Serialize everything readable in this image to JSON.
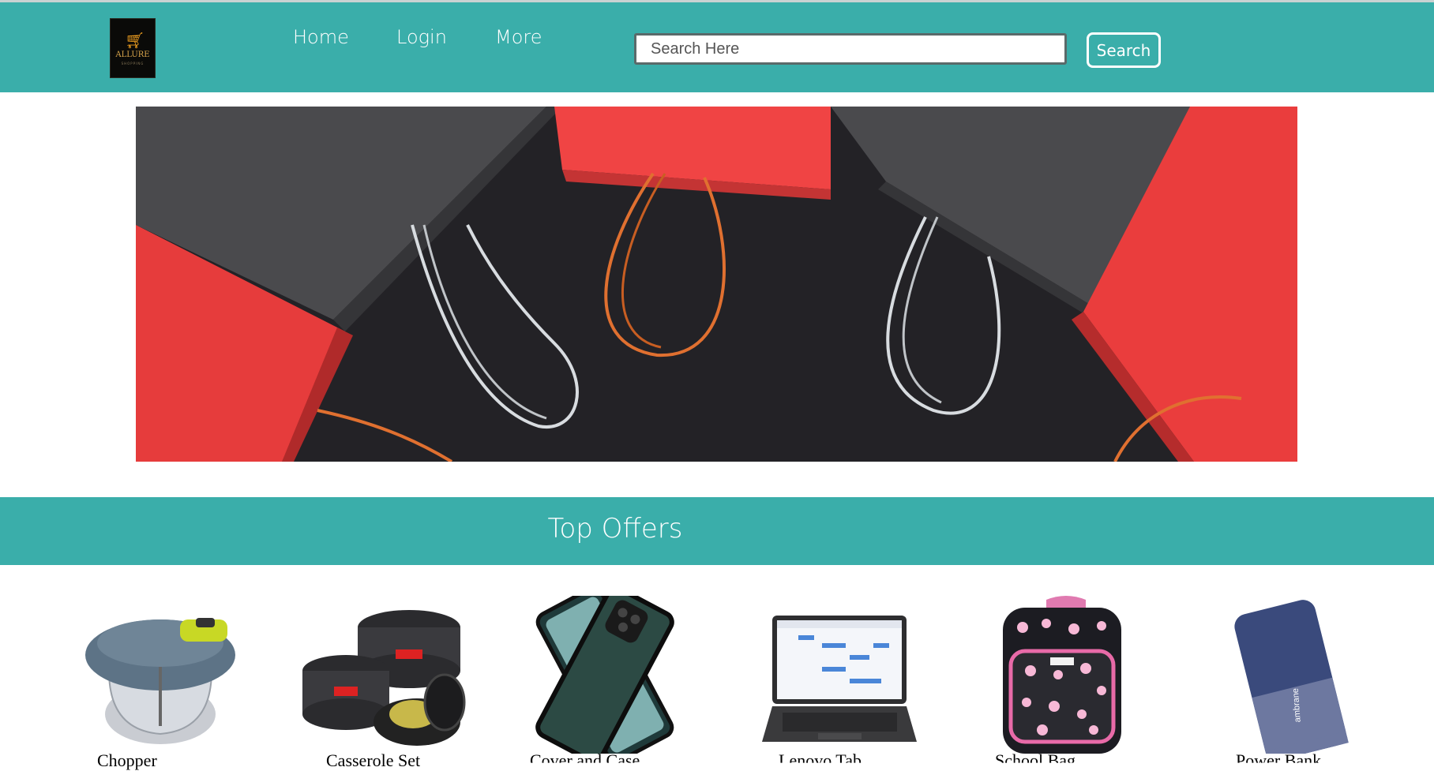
{
  "header": {
    "logo_text": "ALLURE",
    "logo_subtext": "SHOPPING",
    "nav": [
      {
        "label": "Home"
      },
      {
        "label": "Login"
      },
      {
        "label": "More"
      }
    ],
    "search": {
      "placeholder": "Search Here",
      "value": ""
    },
    "search_button": "Search"
  },
  "banner": {
    "description_icon": "shopping-bags-image"
  },
  "offers": {
    "title": "Top Offers",
    "products": [
      {
        "name": "Chopper",
        "icon": "chopper-image"
      },
      {
        "name": "Casserole Set",
        "icon": "casserole-image"
      },
      {
        "name": "Cover and Case",
        "icon": "phone-case-image"
      },
      {
        "name": "Lenovo Tab",
        "icon": "tablet-image"
      },
      {
        "name": "School Bag",
        "icon": "backpack-image"
      },
      {
        "name": "Power Bank",
        "icon": "power-bank-image"
      }
    ]
  },
  "colors": {
    "primary": "#3aaeaa",
    "text_light": "#ffffff"
  }
}
